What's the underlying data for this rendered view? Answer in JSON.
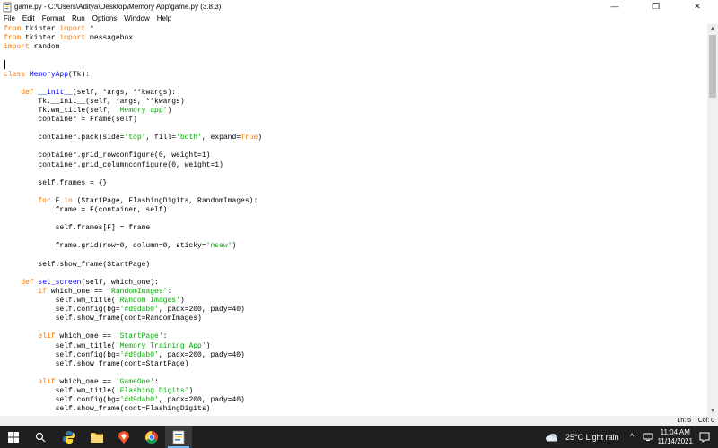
{
  "window": {
    "title": "game.py - C:\\Users\\Aditya\\Desktop\\Memory App\\game.py (3.8.3)",
    "minimize": "—",
    "maximize": "❐",
    "close": "✕"
  },
  "menu": [
    "File",
    "Edit",
    "Format",
    "Run",
    "Options",
    "Window",
    "Help"
  ],
  "code": [
    "from tkinter import *",
    "from tkinter import messagebox",
    "import random",
    "",
    "",
    "class MemoryApp(Tk):",
    "",
    "    def __init__(self, *args, **kwargs):",
    "        Tk.__init__(self, *args, **kwargs)",
    "        Tk.wm_title(self, 'Memory app')",
    "        container = Frame(self)",
    "",
    "        container.pack(side='top', fill='both', expand=True)",
    "",
    "        container.grid_rowconfigure(0, weight=1)",
    "        container.grid_columnconfigure(0, weight=1)",
    "",
    "        self.frames = {}",
    "",
    "        for F in (StartPage, FlashingDigits, RandomImages):",
    "            frame = F(container, self)",
    "",
    "            self.frames[F] = frame",
    "",
    "            frame.grid(row=0, column=0, sticky='nsew')",
    "",
    "        self.show_frame(StartPage)",
    "",
    "    def set_screen(self, which_one):",
    "        if which_one == 'RandomImages':",
    "            self.wm_title('Random Images')",
    "            self.config(bg='#d9dab0', padx=200, pady=40)",
    "            self.show_frame(cont=RandomImages)",
    "",
    "        elif which_one == 'StartPage':",
    "            self.wm_title('Memory Training App')",
    "            self.config(bg='#d9dab0', padx=200, pady=40)",
    "            self.show_frame(cont=StartPage)",
    "",
    "        elif which_one == 'GameOne':",
    "            self.wm_title('Flashing Digits')",
    "            self.config(bg='#d9dab0', padx=200, pady=40)",
    "            self.show_frame(cont=FlashingDigits)"
  ],
  "status": {
    "line": "Ln: 5",
    "col": "Col: 0"
  },
  "tray": {
    "weather": "25°C  Light rain",
    "time": "11:04 AM",
    "date": "11/14/2021",
    "chevron": "^"
  },
  "colors": {
    "keyword": "#ff7700",
    "string": "#00aa00",
    "definition": "#0000ff",
    "builtin": "#900090",
    "taskbar": "#1f1f1f"
  },
  "taskbar_icons": [
    "windows-start-icon",
    "search-icon",
    "python-snake-icon",
    "file-explorer-icon",
    "brave-browser-icon",
    "chrome-icon",
    "idle-editor-icon"
  ]
}
